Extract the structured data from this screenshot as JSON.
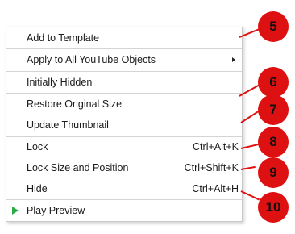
{
  "menu": {
    "items": [
      {
        "label": "Add to Template",
        "shortcut": ""
      },
      {
        "label": "Apply to All YouTube Objects",
        "shortcut": ""
      },
      {
        "label": "Initially Hidden",
        "shortcut": ""
      },
      {
        "label": "Restore Original Size",
        "shortcut": ""
      },
      {
        "label": "Update Thumbnail",
        "shortcut": ""
      },
      {
        "label": "Lock",
        "shortcut": "Ctrl+Alt+K"
      },
      {
        "label": "Lock Size and Position",
        "shortcut": "Ctrl+Shift+K"
      },
      {
        "label": "Hide",
        "shortcut": "Ctrl+Alt+H"
      },
      {
        "label": "Play Preview",
        "shortcut": ""
      }
    ]
  },
  "callouts": [
    "5",
    "6",
    "7",
    "8",
    "9",
    "10"
  ],
  "colors": {
    "callout": "#dd1111",
    "play_icon": "#2eaa47"
  },
  "icons": {
    "submenu": "chevron-right-icon",
    "play": "play-icon"
  }
}
